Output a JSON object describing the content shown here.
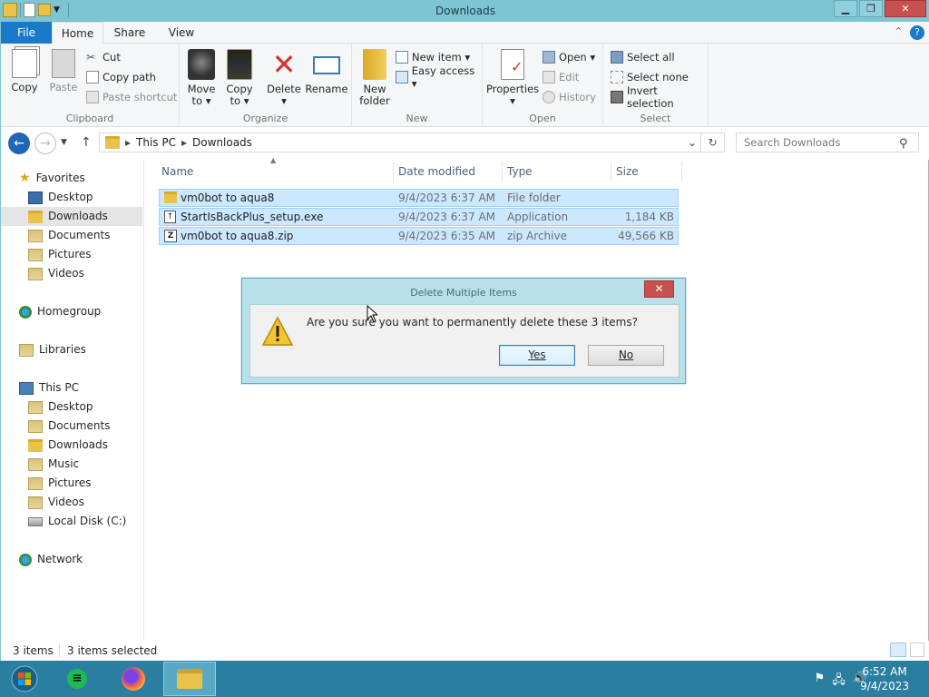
{
  "window": {
    "title": "Downloads"
  },
  "tabs": {
    "file": "File",
    "home": "Home",
    "share": "Share",
    "view": "View"
  },
  "ribbon": {
    "clipboard": {
      "copy": "Copy",
      "paste": "Paste",
      "cut": "Cut",
      "copy_path": "Copy path",
      "paste_shortcut": "Paste shortcut",
      "label": "Clipboard"
    },
    "organize": {
      "move_to": "Move",
      "move_to2": "to ▾",
      "copy_to": "Copy",
      "copy_to2": "to ▾",
      "delete": "Delete",
      "delete2": "▾",
      "rename": "Rename",
      "label": "Organize"
    },
    "new": {
      "new_folder": "New",
      "new_folder2": "folder",
      "new_item": "New item ▾",
      "easy_access": "Easy access ▾",
      "label": "New"
    },
    "open": {
      "properties": "Properties",
      "properties2": "▾",
      "open": "Open ▾",
      "edit": "Edit",
      "history": "History",
      "label": "Open"
    },
    "select": {
      "select_all": "Select all",
      "select_none": "Select none",
      "invert": "Invert selection",
      "label": "Select"
    }
  },
  "address": {
    "this_pc": "This PC",
    "downloads": "Downloads",
    "sep": "▸",
    "search_placeholder": "Search Downloads"
  },
  "nav": {
    "favorites": "Favorites",
    "desktop": "Desktop",
    "downloads": "Downloads",
    "documents": "Documents",
    "pictures": "Pictures",
    "videos": "Videos",
    "homegroup": "Homegroup",
    "libraries": "Libraries",
    "this_pc": "This PC",
    "pc_desktop": "Desktop",
    "pc_documents": "Documents",
    "pc_downloads": "Downloads",
    "pc_music": "Music",
    "pc_pictures": "Pictures",
    "pc_videos": "Videos",
    "pc_local_disk": "Local Disk (C:)",
    "network": "Network"
  },
  "columns": {
    "name": "Name",
    "date": "Date modified",
    "type": "Type",
    "size": "Size"
  },
  "files": [
    {
      "name": "vm0bot to aqua8",
      "date": "9/4/2023 6:37 AM",
      "type": "File folder",
      "size": ""
    },
    {
      "name": "StartIsBackPlus_setup.exe",
      "date": "9/4/2023 6:37 AM",
      "type": "Application",
      "size": "1,184 KB"
    },
    {
      "name": "vm0bot to aqua8.zip",
      "date": "9/4/2023 6:35 AM",
      "type": "zip Archive",
      "size": "49,566 KB"
    }
  ],
  "dialog": {
    "title": "Delete Multiple Items",
    "message": "Are you sure you want to permanently delete these 3 items?",
    "yes": "Yes",
    "no": "No",
    "close": "✕"
  },
  "status": {
    "count": "3 items",
    "selected": "3 items selected"
  },
  "clock": {
    "time": "6:52 AM",
    "date": "9/4/2023"
  }
}
